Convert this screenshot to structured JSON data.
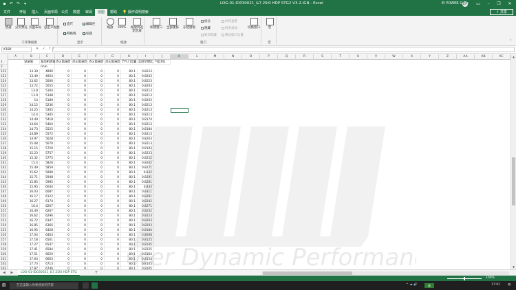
{
  "window": {
    "title": "LOG-01-ID030021_&7.25l0 HDP STG2 V3-2.IGN  -  Excel",
    "user": "EI POWER Grup",
    "avatar_initials": "EP",
    "accent": "#217346"
  },
  "ribbon_tabs": [
    {
      "label": "文件",
      "active": false
    },
    {
      "label": "开始",
      "active": false
    },
    {
      "label": "插入",
      "active": false
    },
    {
      "label": "页面布局",
      "active": false
    },
    {
      "label": "公式",
      "active": false
    },
    {
      "label": "数据",
      "active": false
    },
    {
      "label": "审阅",
      "active": false
    },
    {
      "label": "视图",
      "active": true
    },
    {
      "label": "帮助",
      "active": false
    },
    {
      "label": "操作说明搜索",
      "active": false
    }
  ],
  "share_label": "共享",
  "ribbon": {
    "workbook_views": {
      "label": "工作簿视图",
      "normal": "普通",
      "page_break": "分页预览",
      "page_layout": "页面布局",
      "custom": "自定义视图"
    },
    "show": {
      "label": "显示",
      "ruler": "直尺",
      "formula_bar": "编辑栏",
      "gridlines": "网格线",
      "headings": "标题"
    },
    "zoom": {
      "label": "缩放",
      "zoom": "缩放",
      "zoom_100": "100%",
      "zoom_selection": "缩放到选定区域"
    },
    "window": {
      "label": "窗口",
      "new_window": "新建窗口",
      "arrange_all": "全部重排",
      "freeze": "冻结窗格",
      "split": "拆分",
      "hide": "隐藏",
      "unhide": "取消隐藏",
      "side_by_side": "并排查看",
      "sync_scroll": "同步滚动",
      "reset_position": "重设窗口位置",
      "switch": "切换窗口"
    },
    "macros": {
      "label": "宏",
      "macros": "宏"
    }
  },
  "formula_bar": {
    "name_box": "K180",
    "buttons": "✕ ✓ fx",
    "formula": ""
  },
  "columns": [
    "A",
    "B",
    "C",
    "D",
    "E",
    "F",
    "G",
    "H",
    "I",
    "J",
    "K",
    "L",
    "M",
    "N",
    "O",
    "P",
    "Q",
    "R",
    "S",
    "T",
    "U",
    "V",
    "W",
    "X",
    "Y",
    "Z",
    "AA",
    "AB",
    "AC"
  ],
  "selected_column": "K",
  "header_rows": {
    "row1": [
      "",
      "记录值",
      "发动机转速",
      "点火角滞后",
      "点火角滞后",
      "点火角滞后",
      "点火角滞后",
      "节气门位置",
      "实际空燃比",
      "气缸列1"
    ],
    "row1_num": "1",
    "row2_num": "2",
    "row2": [
      "",
      "",
      "/min",
      "",
      "",
      "",
      "",
      "",
      "",
      ""
    ]
  },
  "data_rows": [
    {
      "n": "122",
      "b": "13.39",
      "c": "4890",
      "i": "0.8223"
    },
    {
      "n": "123",
      "b": "13.49",
      "c": "4954",
      "i": "0.8203"
    },
    {
      "n": "124",
      "b": "13.62",
      "c": "5000",
      "i": "0.8223"
    },
    {
      "n": "125",
      "b": "13.72",
      "c": "5055",
      "i": "0.8203"
    },
    {
      "n": "126",
      "b": "13.8",
      "c": "5104",
      "i": "0.8213"
    },
    {
      "n": "127",
      "b": "13.9",
      "c": "5148",
      "i": "0.8213"
    },
    {
      "n": "128",
      "b": "14",
      "c": "5189",
      "i": "0.8203"
    },
    {
      "n": "129",
      "b": "14.15",
      "c": "5236",
      "i": "0.8213"
    },
    {
      "n": "130",
      "b": "14.25",
      "c": "5305",
      "i": "0.8213"
    },
    {
      "n": "131",
      "b": "14.4",
      "c": "5345",
      "i": "0.8213"
    },
    {
      "n": "132",
      "b": "14.49",
      "c": "5418",
      "i": "0.8174"
    },
    {
      "n": "133",
      "b": "14.64",
      "c": "5464",
      "i": "0.8213"
    },
    {
      "n": "134",
      "b": "14.73",
      "c": "5525",
      "i": "0.8184"
    },
    {
      "n": "135",
      "b": "14.89",
      "c": "5572",
      "i": "0.8213"
    },
    {
      "n": "136",
      "b": "14.97",
      "c": "5628",
      "i": "0.8203"
    },
    {
      "n": "137",
      "b": "15.08",
      "c": "5670",
      "i": "0.8213"
    },
    {
      "n": "138",
      "b": "15.15",
      "c": "5720",
      "i": "0.8193"
    },
    {
      "n": "139",
      "b": "15.23",
      "c": "5757",
      "i": "0.8223"
    },
    {
      "n": "140",
      "b": "15.32",
      "c": "5775",
      "i": "0.8252"
    },
    {
      "n": "141",
      "b": "15.4",
      "c": "5826",
      "i": "0.8262"
    },
    {
      "n": "142",
      "b": "15.49",
      "c": "5859",
      "i": "0.8271"
    },
    {
      "n": "143",
      "b": "15.62",
      "c": "5898",
      "i": "0.832"
    },
    {
      "n": "144",
      "b": "15.71",
      "c": "5948",
      "i": "0.8291"
    },
    {
      "n": "145",
      "b": "15.85",
      "c": "5985",
      "i": "0.8281"
    },
    {
      "n": "146",
      "b": "15.95",
      "c": "6044",
      "i": "0.833"
    },
    {
      "n": "147",
      "b": "16.03",
      "c": "6087",
      "i": "0.8311"
    },
    {
      "n": "148",
      "b": "16.17",
      "c": "6122",
      "i": "0.8291"
    },
    {
      "n": "149",
      "b": "16.27",
      "c": "6174",
      "i": "0.8242"
    },
    {
      "n": "150",
      "b": "16.4",
      "c": "6207",
      "i": "0.8271"
    },
    {
      "n": "151",
      "b": "16.49",
      "c": "6267",
      "i": "0.8232"
    },
    {
      "n": "152",
      "b": "16.62",
      "c": "6296",
      "i": "0.8223"
    },
    {
      "n": "153",
      "b": "16.72",
      "c": "6347",
      "i": "0.8203"
    },
    {
      "n": "154",
      "b": "16.85",
      "c": "6366",
      "i": "0.8203"
    },
    {
      "n": "155",
      "b": "16.95",
      "c": "6428",
      "i": "0.8184"
    },
    {
      "n": "156",
      "b": "17.04",
      "c": "6463",
      "i": "0.8008"
    },
    {
      "n": "157",
      "b": "17.18",
      "c": "6501",
      "i": "0.8125"
    },
    {
      "n": "158",
      "b": "17.27",
      "c": "6547",
      "i": "0.8145"
    },
    {
      "n": "159",
      "b": "17.41",
      "c": "6584",
      "i": "0.8125"
    },
    {
      "n": "160",
      "b": "17.51",
      "c": "6620",
      "i": "0.8164"
    },
    {
      "n": "161",
      "b": "17.64",
      "c": "6663",
      "i": "0.8154"
    },
    {
      "n": "162",
      "b": "17.73",
      "c": "6713",
      "i": "0.8105"
    },
    {
      "n": "163",
      "b": "17.87",
      "c": "6746",
      "i": "0.8105"
    },
    {
      "n": "164",
      "b": "17.97",
      "c": "6798",
      "i": "0.8096"
    },
    {
      "n": "165",
      "b": "18.08",
      "c": "6829",
      "i": "0.8076"
    },
    {
      "n": "166",
      "b": "18.17",
      "c": "6877",
      "i": "0.8066"
    }
  ],
  "zero_value": "0",
  "h_value": "80.1",
  "watermark_text": "Power Dynamic Performance",
  "sheet_tab": "LOG-01-ID030021_&7.25l0 HDP STG",
  "add_sheet": "+",
  "status": {
    "ready": "",
    "zoom": "100%"
  },
  "taskbar": {
    "search_placeholder": "在这里输入你要搜索的内容",
    "tray_text": "^ ☁ 🔊",
    "lang": "英",
    "time": "17:02"
  }
}
